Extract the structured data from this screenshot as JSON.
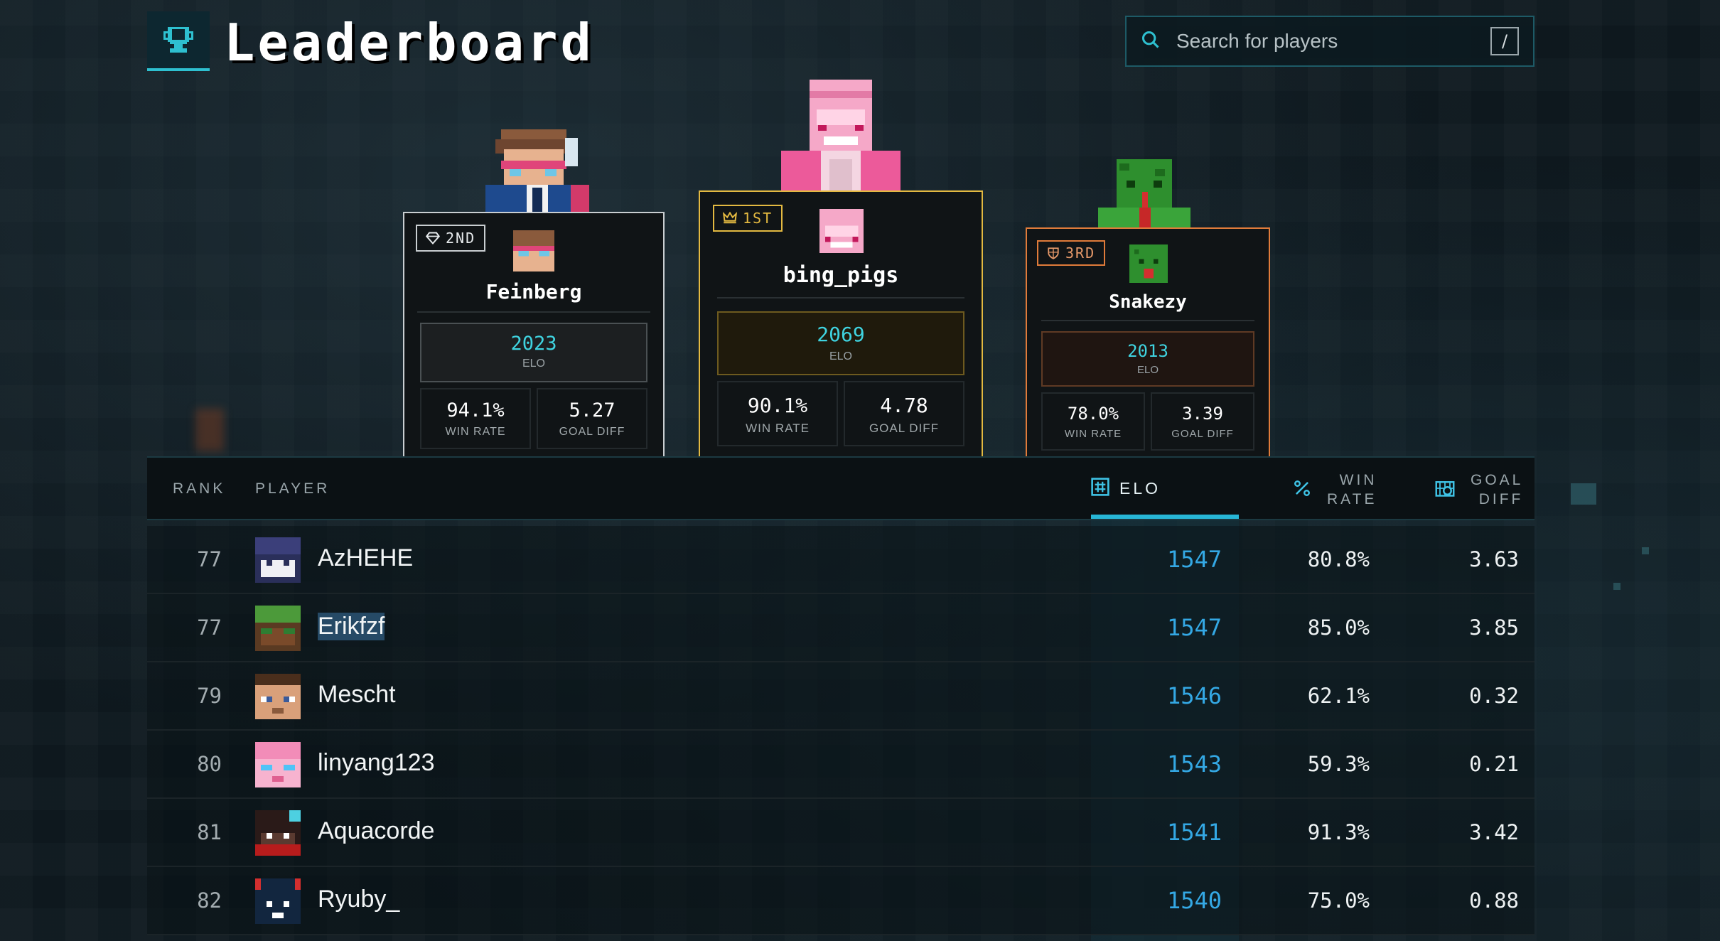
{
  "header": {
    "title": "Leaderboard",
    "search_placeholder": "Search for players",
    "search_shortcut": "/"
  },
  "podium": {
    "first": {
      "badge": "1ST",
      "name": "bing_pigs",
      "elo": "2069",
      "elo_label": "ELO",
      "win_rate": "90.1%",
      "win_rate_label": "WIN RATE",
      "goal_diff": "4.78",
      "goal_diff_label": "GOAL DIFF",
      "accent": "#e3b941"
    },
    "second": {
      "badge": "2ND",
      "name": "Feinberg",
      "elo": "2023",
      "elo_label": "ELO",
      "win_rate": "94.1%",
      "win_rate_label": "WIN RATE",
      "goal_diff": "5.27",
      "goal_diff_label": "GOAL DIFF",
      "accent": "#c9ced1"
    },
    "third": {
      "badge": "3RD",
      "name": "Snakezy",
      "elo": "2013",
      "elo_label": "ELO",
      "win_rate": "78.0%",
      "win_rate_label": "WIN RATE",
      "goal_diff": "3.39",
      "goal_diff_label": "GOAL DIFF",
      "accent": "#e07b3a"
    }
  },
  "table": {
    "headers": {
      "rank": "RANK",
      "player": "PLAYER",
      "elo": "ELO",
      "win_rate_1": "WIN",
      "win_rate_2": "RATE",
      "goal_diff_1": "GOAL",
      "goal_diff_2": "DIFF"
    },
    "rows": [
      {
        "rank": "77",
        "name": "AzHEHE",
        "elo": "1547",
        "win_rate": "80.8%",
        "goal_diff": "3.63"
      },
      {
        "rank": "77",
        "name": "Erikfzf",
        "elo": "1547",
        "win_rate": "85.0%",
        "goal_diff": "3.85"
      },
      {
        "rank": "79",
        "name": "Mescht",
        "elo": "1546",
        "win_rate": "62.1%",
        "goal_diff": "0.32"
      },
      {
        "rank": "80",
        "name": "linyang123",
        "elo": "1543",
        "win_rate": "59.3%",
        "goal_diff": "0.21"
      },
      {
        "rank": "81",
        "name": "Aquacorde",
        "elo": "1541",
        "win_rate": "91.3%",
        "goal_diff": "3.42"
      },
      {
        "rank": "82",
        "name": "Ryuby_",
        "elo": "1540",
        "win_rate": "75.0%",
        "goal_diff": "0.88"
      }
    ]
  },
  "colors": {
    "accent_cyan": "#2ec0d0",
    "elo_blue": "#34a8e4",
    "gold": "#e3b941",
    "silver": "#c9ced1",
    "bronze": "#e07b3a"
  }
}
